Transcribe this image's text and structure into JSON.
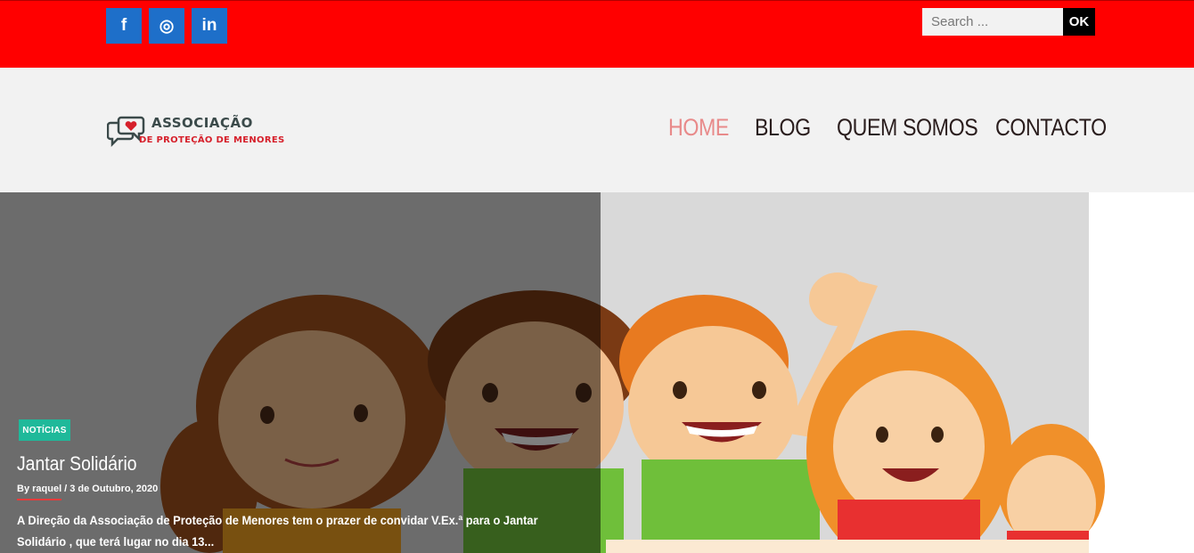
{
  "topbar": {
    "social": [
      {
        "name": "facebook",
        "glyph": "f"
      },
      {
        "name": "instagram",
        "glyph": "◎"
      },
      {
        "name": "linkedin",
        "glyph": "in"
      }
    ],
    "search_placeholder": "Search ...",
    "search_button": "OK"
  },
  "header": {
    "logo_line1": "ASSOCIAÇÃO",
    "logo_line2": "DE PROTEÇÃO DE MENORES",
    "nav": [
      "HOME",
      "BLOG",
      "QUEM SOMOS",
      "CONTACTO"
    ],
    "active_nav": "HOME"
  },
  "post": {
    "category": "NOTÍCIAS",
    "title": "Jantar Solidário",
    "author_label": "By raquel",
    "separator": "/",
    "date": "3 de Outubro, 2020",
    "excerpt": "A Direção da Associação de Proteção de Menores tem o prazer de convidar V.Ex.ª para o Jantar Solidário , que terá lugar no dia 13..."
  },
  "colors": {
    "topbar": "#ff0000",
    "social_bg": "#1e6fc9",
    "header_bg": "#f2f2f2",
    "active_nav": "#e88a8a",
    "badge": "#1fb99a",
    "accent_line": "#e63c3c"
  }
}
